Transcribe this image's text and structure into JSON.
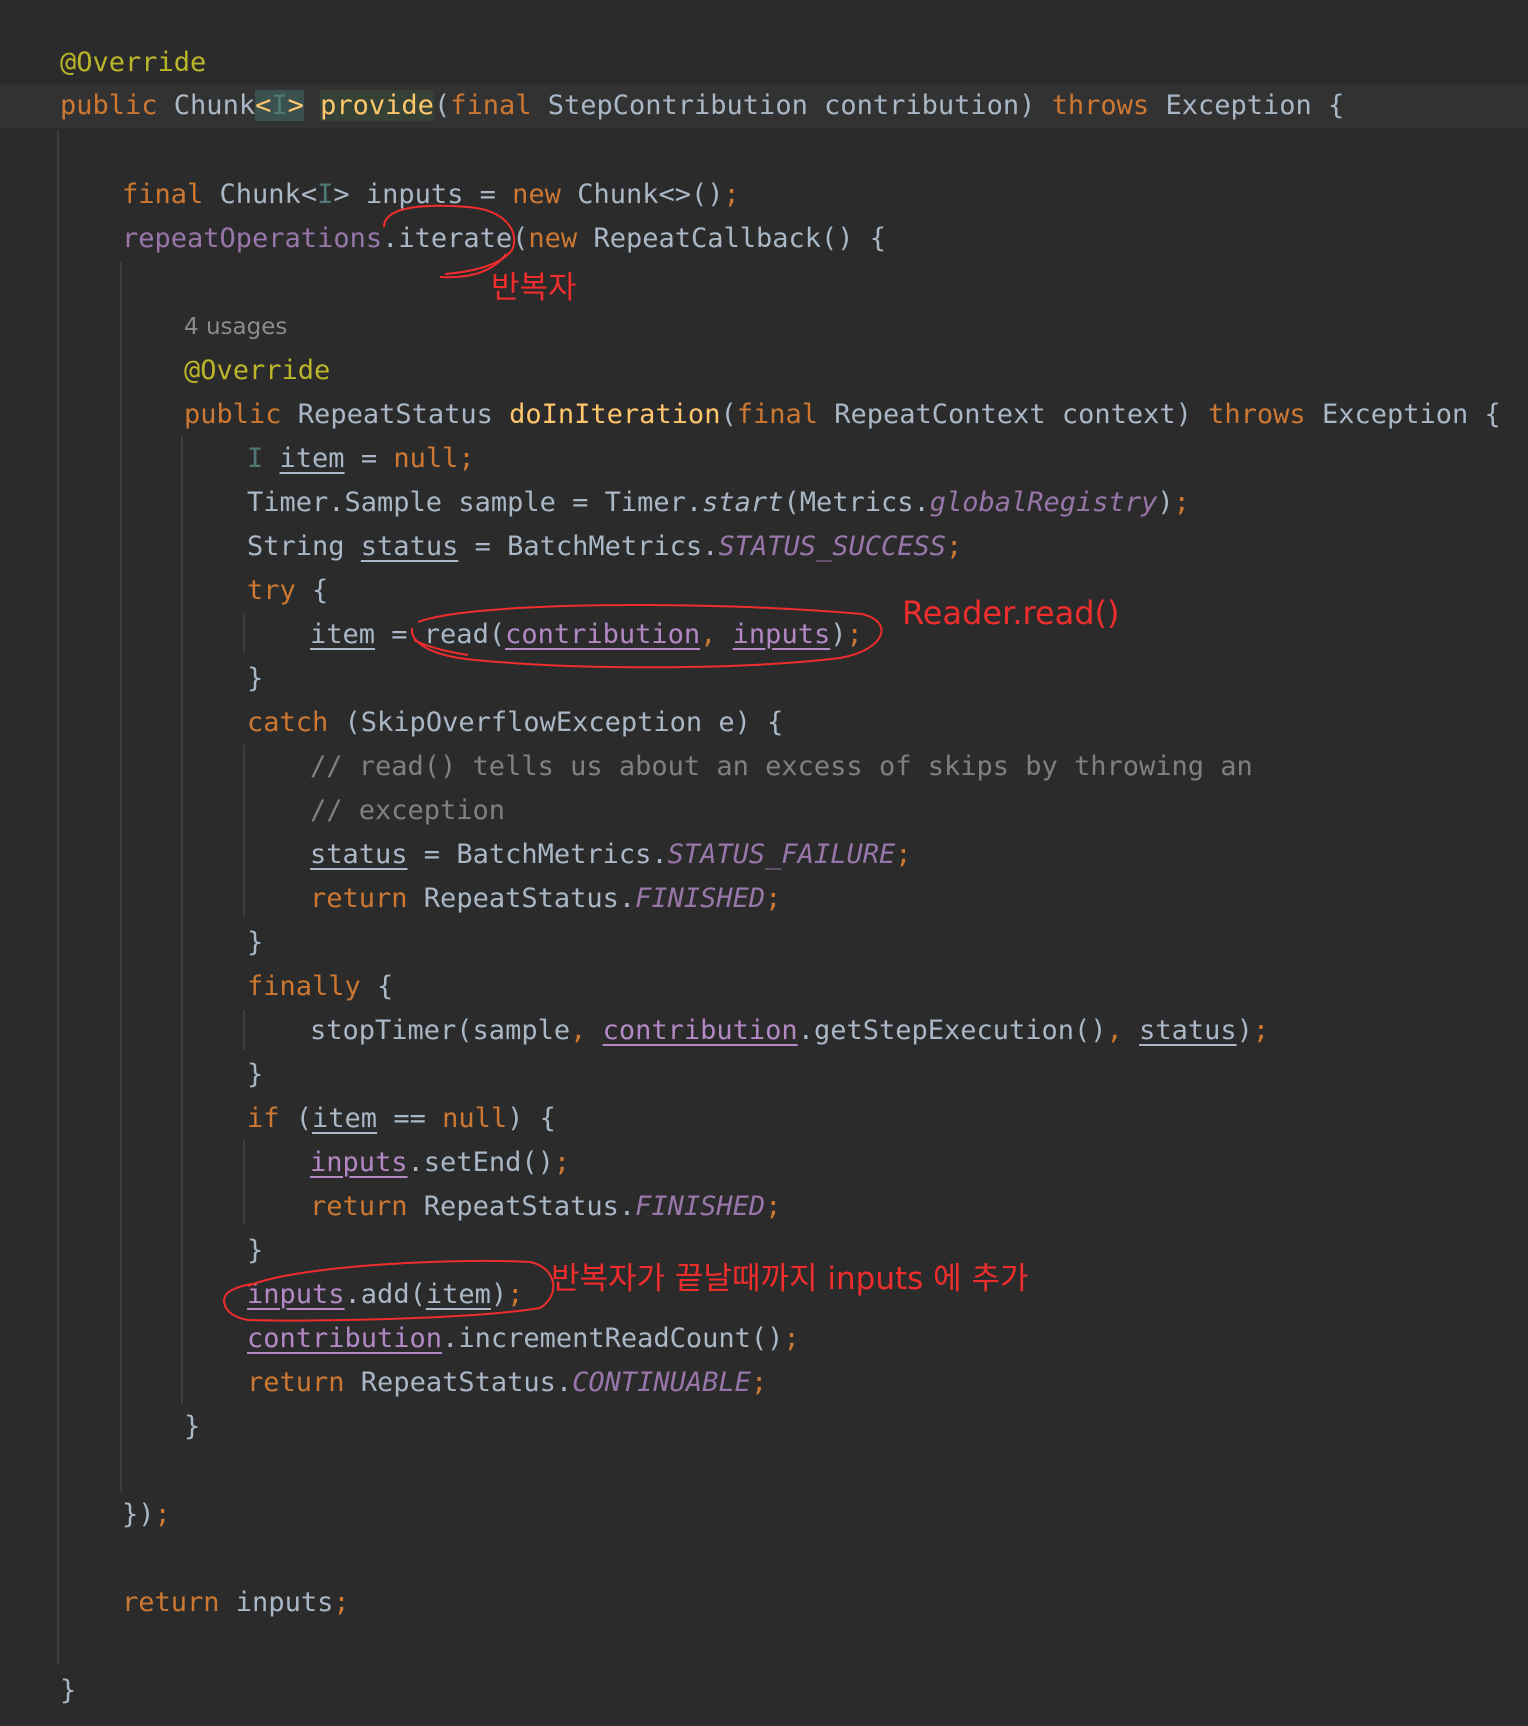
{
  "editor": {
    "lines": {
      "l1": "@Override",
      "l2": {
        "a": "public ",
        "b": "Chunk",
        "c": "<",
        "d": "I",
        "e": ">",
        "f": " ",
        "g": "provide",
        "h": "(",
        "i": "final",
        "j": " StepContribution contribution) ",
        "k": "throws",
        "l": " Exception {"
      },
      "l3": {
        "a": "final",
        "b": " Chunk<",
        "c": "I",
        "d": "> inputs = ",
        "e": "new",
        "f": " Chunk<>()",
        "g": ";"
      },
      "l4": {
        "a": "repeatOperations",
        "b": ".iterate(",
        "c": "new",
        "d": " RepeatCallback() {"
      },
      "l5": "4 usages",
      "l6": "@Override",
      "l7": {
        "a": "public",
        "b": " RepeatStatus ",
        "c": "doInIteration",
        "d": "(",
        "e": "final",
        "f": " RepeatContext context) ",
        "g": "throws",
        "h": " Exception {"
      },
      "l8": {
        "a": "I",
        "b": " ",
        "c": "item",
        "d": " = ",
        "e": "null",
        "f": ";"
      },
      "l9": {
        "a": "Timer.Sample sample = Timer.",
        "b": "start",
        "c": "(Metrics.",
        "d": "globalRegistry",
        "e": ")",
        "f": ";"
      },
      "l10": {
        "a": "String ",
        "b": "status",
        "c": " = BatchMetrics.",
        "d": "STATUS_SUCCESS",
        "e": ";"
      },
      "l11": {
        "a": "try",
        "b": " {"
      },
      "l12": {
        "a": "item",
        "b": " = read(",
        "c": "contribution",
        "d": ", ",
        "e": "inputs",
        "f": ")",
        "g": ";"
      },
      "l13": "}",
      "l14": {
        "a": "catch",
        "b": " (SkipOverflowException e) {"
      },
      "l15": "// read() tells us about an excess of skips by throwing an",
      "l16": "// exception",
      "l17": {
        "a": "status",
        "b": " = BatchMetrics.",
        "c": "STATUS_FAILURE",
        "d": ";"
      },
      "l18": {
        "a": "return",
        "b": " RepeatStatus.",
        "c": "FINISHED",
        "d": ";"
      },
      "l19": "}",
      "l20": {
        "a": "finally",
        "b": " {"
      },
      "l21": {
        "a": "stopTimer(sample",
        "b": ", ",
        "c": "contribution",
        "d": ".getStepExecution()",
        "e": ", ",
        "f": "status",
        "g": ")",
        "h": ";"
      },
      "l22": "}",
      "l23": {
        "a": "if",
        "b": " (",
        "c": "item",
        "d": " == ",
        "e": "null",
        "f": ") {"
      },
      "l24": {
        "a": "inputs",
        "b": ".setEnd()",
        "c": ";"
      },
      "l25": {
        "a": "return",
        "b": " RepeatStatus.",
        "c": "FINISHED",
        "d": ";"
      },
      "l26": "}",
      "l27": {
        "a": "inputs",
        "b": ".add(",
        "c": "item",
        "d": ")",
        "e": ";"
      },
      "l28": {
        "a": "contribution",
        "b": ".incrementReadCount()",
        "c": ";"
      },
      "l29": {
        "a": "return",
        "b": " RepeatStatus.",
        "c": "CONTINUABLE",
        "d": ";"
      },
      "l30": "}",
      "l31": {
        "a": "})",
        "b": ";"
      },
      "l32": {
        "a": "return",
        "b": " inputs",
        "c": ";"
      },
      "l33": "}"
    }
  },
  "annotations": {
    "iterate_note": "반복자",
    "read_note": "Reader.read()",
    "add_note": "반복자가 끝날때까지 inputs 에 추가",
    "color": "#ef2d2d"
  }
}
